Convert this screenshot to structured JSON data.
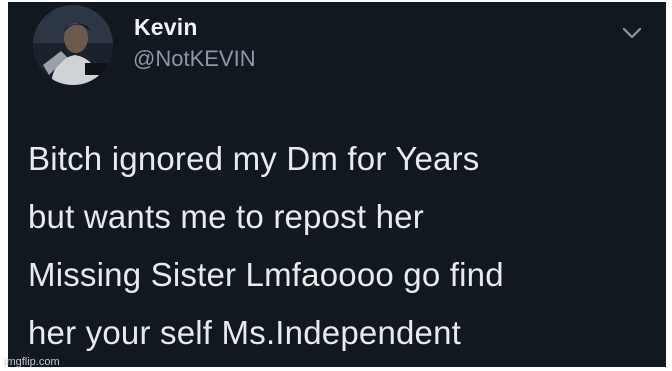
{
  "tweet": {
    "author_name": "Kevin",
    "author_handle": "@NotKEVIN",
    "text": "Bitch ignored my Dm for Years\nbut wants me to repost her\nMissing Sister Lmfaoooo go find\nher your self Ms.Independent",
    "menu_icon": "chevron-down-icon",
    "avatar_icon": "profile-photo"
  },
  "watermark": "imgflip.com",
  "colors": {
    "background": "#121820",
    "text": "#e8eaec",
    "handle": "#8b98a5"
  }
}
